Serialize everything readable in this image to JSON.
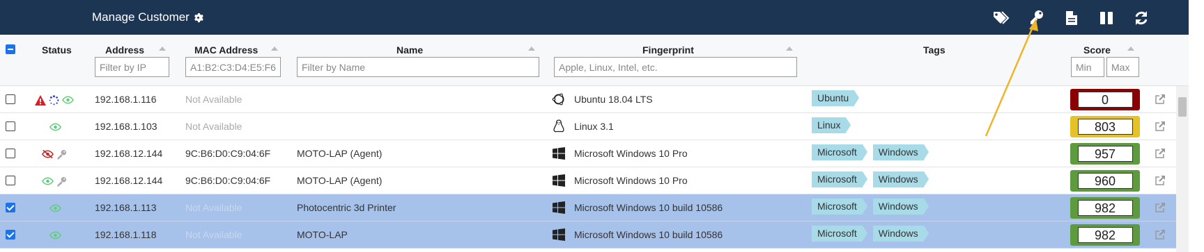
{
  "topbar": {
    "title": "Manage Customer",
    "icons": [
      "tags-icon",
      "key-icon",
      "document-icon",
      "pause-columns-icon",
      "refresh-icon"
    ]
  },
  "columns": {
    "status": "Status",
    "address": "Address",
    "mac": "MAC Address",
    "name": "Name",
    "fingerprint": "Fingerprint",
    "tags": "Tags",
    "score": "Score"
  },
  "filters": {
    "ip_placeholder": "Filter by IP",
    "mac_placeholder": "A1:B2:C3:D4:E5:F6",
    "name_placeholder": "Filter by Name",
    "fp_placeholder": "Apple, Linux, Intel, etc.",
    "min_placeholder": "Min",
    "max_placeholder": "Max"
  },
  "rows": [
    {
      "checked": false,
      "status": [
        "warning-icon",
        "spinner-icon",
        "eye-icon"
      ],
      "address": "192.168.1.116",
      "mac": "Not Available",
      "name": "",
      "os_icon": "ubuntu-icon",
      "fingerprint": "Ubuntu 18.04 LTS",
      "tags": [
        "Ubuntu"
      ],
      "score": "0",
      "score_color": "#8b0000"
    },
    {
      "checked": false,
      "status": [
        "eye-icon"
      ],
      "address": "192.168.1.103",
      "mac": "Not Available",
      "name": "",
      "os_icon": "linux-icon",
      "fingerprint": "Linux 3.1",
      "tags": [
        "Linux"
      ],
      "score": "803",
      "score_color": "#e6c229"
    },
    {
      "checked": false,
      "status": [
        "eye-slash-icon",
        "key-icon"
      ],
      "address": "192.168.12.144",
      "mac": "9C:B6:D0:C9:04:6F",
      "name": "MOTO-LAP (Agent)",
      "os_icon": "windows-icon",
      "fingerprint": "Microsoft Windows 10 Pro",
      "tags": [
        "Microsoft",
        "Windows"
      ],
      "score": "957",
      "score_color": "#5e9b3e"
    },
    {
      "checked": false,
      "status": [
        "eye-icon",
        "key-icon"
      ],
      "address": "192.168.12.144",
      "mac": "9C:B6:D0:C9:04:6F",
      "name": "MOTO-LAP (Agent)",
      "os_icon": "windows-icon",
      "fingerprint": "Microsoft Windows 10 Pro",
      "tags": [
        "Microsoft",
        "Windows"
      ],
      "score": "960",
      "score_color": "#5e9b3e"
    },
    {
      "checked": true,
      "status": [
        "eye-icon"
      ],
      "address": "192.168.1.113",
      "mac": "Not Available",
      "name": "Photocentric 3d Printer",
      "os_icon": "windows-icon",
      "fingerprint": "Microsoft Windows 10 build 10586",
      "tags": [
        "Microsoft",
        "Windows"
      ],
      "score": "982",
      "score_color": "#5e9b3e"
    },
    {
      "checked": true,
      "status": [
        "eye-icon"
      ],
      "address": "192.168.1.118",
      "mac": "Not Available",
      "name": "MOTO-LAP",
      "os_icon": "windows-icon",
      "fingerprint": "Microsoft Windows 10 build 10586",
      "tags": [
        "Microsoft",
        "Windows"
      ],
      "score": "982",
      "score_color": "#5e9b3e"
    }
  ],
  "colors": {
    "topbar": "#1c3553",
    "selected_row": "#a7c2ea",
    "tag": "#a8dbe8",
    "annotation_arrow": "#f0b429"
  }
}
